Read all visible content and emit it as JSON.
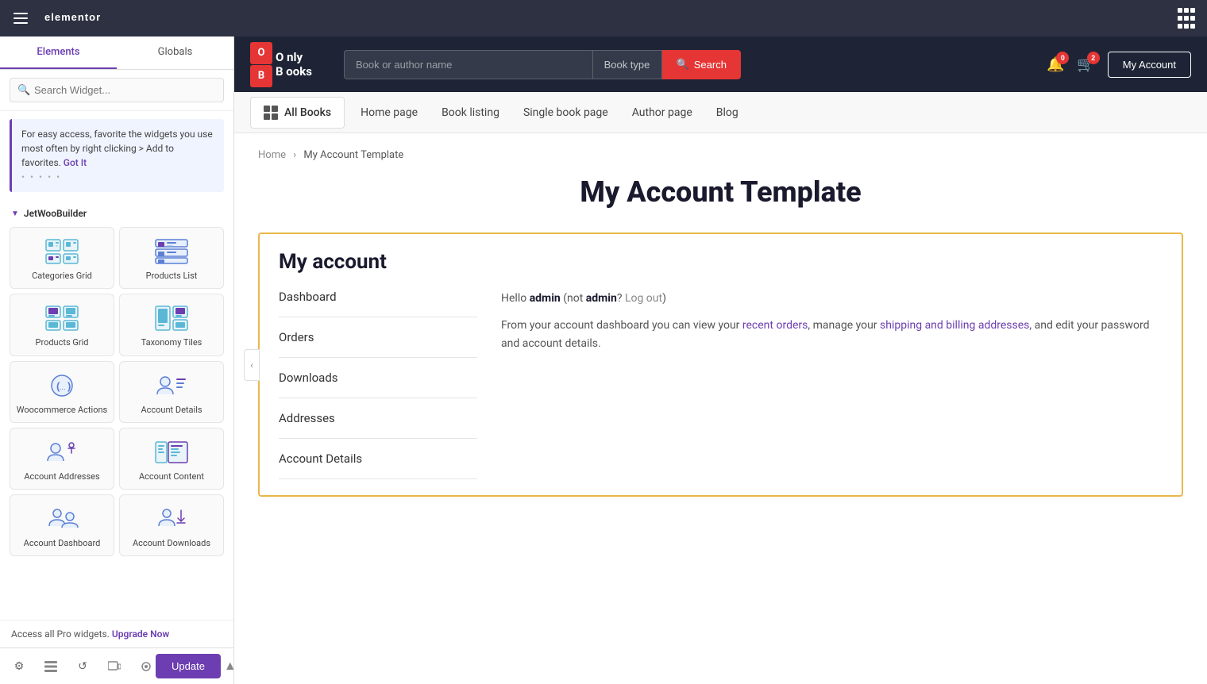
{
  "toolbar": {
    "app_name": "elementor",
    "tabs": [
      {
        "label": "Elements",
        "active": true
      },
      {
        "label": "Globals",
        "active": false
      }
    ],
    "search_placeholder": "Search Widget...",
    "info_text": "For easy access, favorite the widgets you use most often by right clicking > Add to favorites.",
    "info_link": "Got It",
    "section_label": "JetWooBuilder",
    "widgets": [
      {
        "id": "categories-grid",
        "label": "Categories Grid"
      },
      {
        "id": "products-list",
        "label": "Products List"
      },
      {
        "id": "products-grid",
        "label": "Products Grid"
      },
      {
        "id": "taxonomy-tiles",
        "label": "Taxonomy Tiles"
      },
      {
        "id": "woocommerce-actions",
        "label": "Woocommerce Actions"
      },
      {
        "id": "account-details",
        "label": "Account Details"
      },
      {
        "id": "account-addresses",
        "label": "Account Addresses"
      },
      {
        "id": "account-content",
        "label": "Account Content"
      },
      {
        "id": "account-dashboard",
        "label": "Account Dashboard"
      },
      {
        "id": "account-downloads",
        "label": "Account Downloads"
      }
    ],
    "upgrade_text": "Access all Pro widgets.",
    "upgrade_link": "Upgrade Now",
    "bottom_icons": [
      "settings",
      "layers",
      "history",
      "responsive",
      "preview"
    ],
    "update_label": "Update",
    "collapse_icon": "▲"
  },
  "site": {
    "logo_line1": "O  nly",
    "logo_line2": "B  ooks",
    "logo_badge1": "O",
    "logo_badge2": "B",
    "search_placeholder": "Book or author name",
    "book_type_placeholder": "Book type",
    "search_button": "Search",
    "notifications_count": "0",
    "cart_count": "2",
    "my_account": "My Account",
    "nav_all_books": "All Books",
    "nav_links": [
      "Home page",
      "Book listing",
      "Single book page",
      "Author page",
      "Blog"
    ]
  },
  "page": {
    "breadcrumb_home": "Home",
    "breadcrumb_current": "My Account Template",
    "title": "My Account Template",
    "section_heading": "My account",
    "nav_items": [
      "Dashboard",
      "Orders",
      "Downloads",
      "Addresses",
      "Account Details"
    ],
    "hello_prefix": "Hello ",
    "hello_user": "admin",
    "hello_mid": " (not ",
    "hello_user2": "admin",
    "hello_suffix": "? ",
    "logout_link": "Log out",
    "logout_close": ")",
    "desc": "From your account dashboard you can view your ",
    "desc_link1": "recent orders",
    "desc_mid": ", manage your ",
    "desc_link2": "shipping and billing addresses",
    "desc_end": ", and edit your password and account details."
  }
}
